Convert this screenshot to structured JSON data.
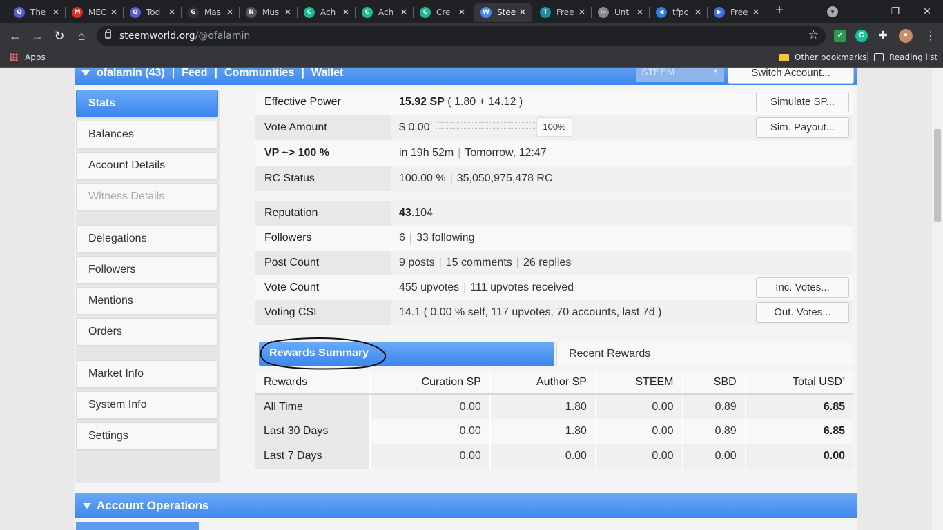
{
  "browser": {
    "tabs": [
      {
        "title": "The",
        "fav_color": "#5b5bd6",
        "fav_glyph": "Q"
      },
      {
        "title": "MEC",
        "fav_color": "#d93025",
        "fav_glyph": "M"
      },
      {
        "title": "Tod",
        "fav_color": "#5b5bd6",
        "fav_glyph": "Q"
      },
      {
        "title": "Mas",
        "fav_color": "#333333",
        "fav_glyph": "G"
      },
      {
        "title": "Mus",
        "fav_color": "#555555",
        "fav_glyph": "N"
      },
      {
        "title": "Ach",
        "fav_color": "#1db992",
        "fav_glyph": "C"
      },
      {
        "title": "Ach",
        "fav_color": "#1db992",
        "fav_glyph": "C"
      },
      {
        "title": "Cre",
        "fav_color": "#1db992",
        "fav_glyph": "C"
      },
      {
        "title": "Stee",
        "fav_color": "#4b8bf4",
        "fav_glyph": "W"
      },
      {
        "title": "Free",
        "fav_color": "#1a8f9f",
        "fav_glyph": "T"
      },
      {
        "title": "Unt",
        "fav_color": "#888888",
        "fav_glyph": "◎"
      },
      {
        "title": "tfpc",
        "fav_color": "#2f7fd8",
        "fav_glyph": "◀"
      },
      {
        "title": "Free",
        "fav_color": "#3f6fd8",
        "fav_glyph": "▶"
      }
    ],
    "close_glyph": "✕",
    "new_tab": "+",
    "url_host": "steemworld.org",
    "url_path": "/@ofalamin",
    "bookmarks": {
      "apps": "Apps",
      "other": "Other bookmarks",
      "reading": "Reading list"
    }
  },
  "header": {
    "user": "ofalamin (43)",
    "sep": "|",
    "feed": "Feed",
    "communities": "Communities",
    "wallet": "Wallet",
    "coin": "STEEM",
    "switch": "Switch Account..."
  },
  "sidebar": {
    "stats": "Stats",
    "balances": "Balances",
    "account_details": "Account Details",
    "witness_details": "Witness Details",
    "delegations": "Delegations",
    "followers": "Followers",
    "mentions": "Mentions",
    "orders": "Orders",
    "market_info": "Market Info",
    "system_info": "System Info",
    "settings": "Settings"
  },
  "stats": {
    "effective_power": {
      "label": "Effective Power",
      "value": "15.92 SP",
      "detail": "( 1.80 + 14.12 )",
      "button": "Simulate SP..."
    },
    "vote_amount": {
      "label": "Vote Amount",
      "value": "$ 0.00",
      "percent": "100%",
      "slider_fill": 1.0,
      "button": "Sim. Payout..."
    },
    "vp": {
      "label": "VP ~> 100 %",
      "value": "in 19h 52m",
      "value2": "Tomorrow, 12:47"
    },
    "rc": {
      "label": "RC Status",
      "value": "100.00 %",
      "value2": "35,050,975,478 RC"
    },
    "reputation": {
      "label": "Reputation",
      "value_int": "43",
      "value_dec": ".104"
    },
    "followers": {
      "label": "Followers",
      "value": "6",
      "value2": "33 following"
    },
    "post_count": {
      "label": "Post Count",
      "value": "9 posts",
      "value2": "15 comments",
      "value3": "26 replies"
    },
    "vote_count": {
      "label": "Vote Count",
      "value": "455 upvotes",
      "value2": "111 upvotes received",
      "button": "Inc. Votes..."
    },
    "voting_csi": {
      "label": "Voting CSI",
      "value": "14.1 ( 0.00 % self, 117 upvotes, 70 accounts, last 7d )",
      "button": "Out. Votes..."
    }
  },
  "rewards": {
    "tab_summary": "Rewards Summary",
    "tab_recent": "Recent Rewards",
    "headers": [
      "Rewards",
      "Curation SP",
      "Author SP",
      "STEEM",
      "SBD",
      "Total USD"
    ],
    "header_sup": "*",
    "rows": [
      [
        "All Time",
        "0.00",
        "1.80",
        "0.00",
        "0.89",
        "6.85"
      ],
      [
        "Last 30 Days",
        "0.00",
        "1.80",
        "0.00",
        "0.89",
        "6.85"
      ],
      [
        "Last 7 Days",
        "0.00",
        "0.00",
        "0.00",
        "0.00",
        "0.00"
      ]
    ]
  },
  "account_operations": "Account Operations",
  "colors": {
    "accent": "#3d87ee",
    "chrome": "#202124"
  }
}
